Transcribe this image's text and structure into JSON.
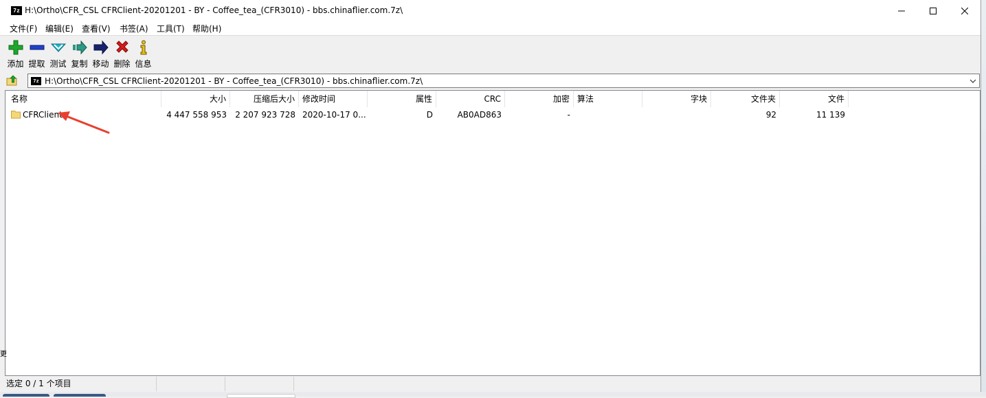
{
  "window": {
    "title": "H:\\Ortho\\CFR_CSL CFRClient-20201201 - BY - Coffee_tea_(CFR3010) - bbs.chinaflier.com.7z\\",
    "app_icon_text": "7z"
  },
  "menu": [
    "文件(F)",
    "编辑(E)",
    "查看(V)",
    "书签(A)",
    "工具(T)",
    "帮助(H)"
  ],
  "toolbar": {
    "add": "添加",
    "extract": "提取",
    "test": "测试",
    "copy": "复制",
    "move": "移动",
    "delete": "删除",
    "info": "信息"
  },
  "address": {
    "path": "H:\\Ortho\\CFR_CSL CFRClient-20201201 - BY - Coffee_tea_(CFR3010) - bbs.chinaflier.com.7z\\"
  },
  "columns": {
    "name": "名称",
    "size": "大小",
    "packed_size": "压缩后大小",
    "modified": "修改时间",
    "attributes": "属性",
    "crc": "CRC",
    "encrypted": "加密",
    "method": "算法",
    "block": "字块",
    "folders": "文件夹",
    "files": "文件"
  },
  "rows": [
    {
      "name": "CFRClient",
      "size": "4 447 558 953",
      "packed_size": "2 207 923 728",
      "modified": "2020-10-17 0...",
      "attributes": "D",
      "crc": "AB0AD863",
      "encrypted": "-",
      "method": "",
      "block": "",
      "folders": "92",
      "files": "11 139"
    }
  ],
  "status": {
    "selection": "选定 0 / 1 个项目"
  },
  "colors": {
    "annotation_arrow": "#e8402f",
    "folder": "#f5d77a",
    "add_icon": "#1fa62c",
    "extract_icon": "#2042c8",
    "test_icon": "#1bb5c9",
    "copy_icon": "#2a9a84",
    "move_icon": "#17236f",
    "delete_icon": "#d81a1a",
    "info_icon": "#e8c21a"
  },
  "edge_glyph": "更"
}
